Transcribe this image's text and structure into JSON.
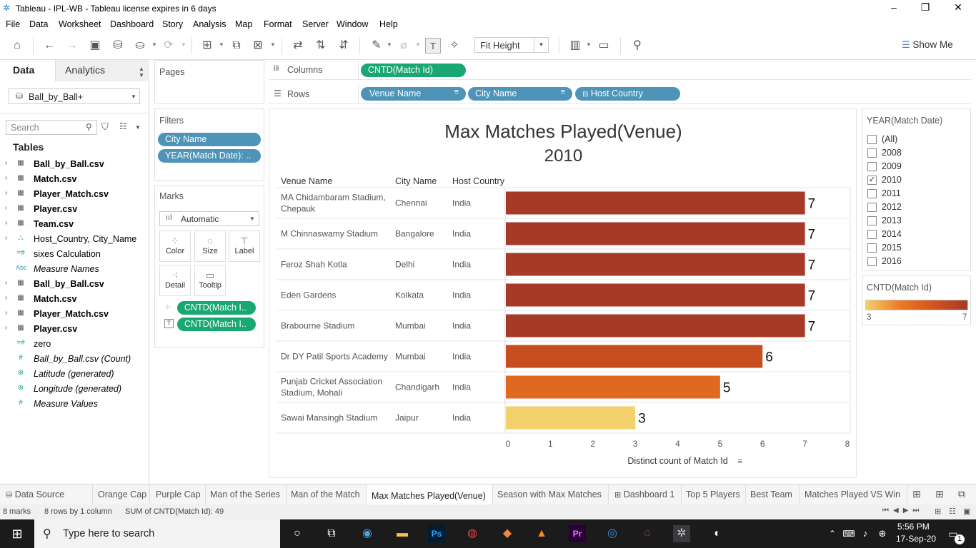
{
  "window": {
    "title": "Tableau - IPL-WB - Tableau license expires in 6 days",
    "controls": [
      "–",
      "❐",
      "✕"
    ]
  },
  "menu": [
    "File",
    "Data",
    "Worksheet",
    "Dashboard",
    "Story",
    "Analysis",
    "Map",
    "Format",
    "Server",
    "Window",
    "Help"
  ],
  "toolbar": {
    "fit": "Fit Height",
    "show_me": "Show Me"
  },
  "left_pane": {
    "tabs": [
      "Data",
      "Analytics"
    ],
    "datasource": "Ball_by_Ball+",
    "search_placeholder": "Search",
    "tables_header": "Tables",
    "fields": [
      {
        "name": "Ball_by_Ball.csv",
        "icon": "table-icon",
        "glyph": "▦",
        "arrow": "›",
        "style": "b"
      },
      {
        "name": "Match.csv",
        "icon": "table-icon",
        "glyph": "▦",
        "arrow": "›",
        "style": "b"
      },
      {
        "name": "Player_Match.csv",
        "icon": "table-icon",
        "glyph": "▦",
        "arrow": "›",
        "style": "b"
      },
      {
        "name": "Player.csv",
        "icon": "table-icon",
        "glyph": "▦",
        "arrow": "›",
        "style": "b"
      },
      {
        "name": "Team.csv",
        "icon": "table-icon",
        "glyph": "▦",
        "arrow": "›",
        "style": "b"
      },
      {
        "name": "Host_Country, City_Name",
        "icon": "hierarchy-icon",
        "glyph": "⛬",
        "arrow": "›",
        "style": ""
      },
      {
        "name": "sixes Calculation",
        "icon": "calc-icon",
        "glyph": "=#",
        "arrow": "",
        "style": ""
      },
      {
        "name": "Measure Names",
        "icon": "abc-icon",
        "glyph": "Abc",
        "arrow": "",
        "style": "it"
      },
      {
        "name": "Ball_by_Ball.csv",
        "icon": "table-icon",
        "glyph": "▦",
        "arrow": "›",
        "style": "b"
      },
      {
        "name": "Match.csv",
        "icon": "table-icon",
        "glyph": "▦",
        "arrow": "›",
        "style": "b"
      },
      {
        "name": "Player_Match.csv",
        "icon": "table-icon",
        "glyph": "▦",
        "arrow": "›",
        "style": "b"
      },
      {
        "name": "Player.csv",
        "icon": "table-icon",
        "glyph": "▦",
        "arrow": "›",
        "style": "b"
      },
      {
        "name": "zero",
        "icon": "calc-icon",
        "glyph": "=#",
        "arrow": "",
        "style": ""
      },
      {
        "name": "Ball_by_Ball.csv (Count)",
        "icon": "number-icon",
        "glyph": "#",
        "arrow": "",
        "style": "it"
      },
      {
        "name": "Latitude (generated)",
        "icon": "globe-icon",
        "glyph": "⊕",
        "arrow": "",
        "style": "it"
      },
      {
        "name": "Longitude (generated)",
        "icon": "globe-icon",
        "glyph": "⊕",
        "arrow": "",
        "style": "it"
      },
      {
        "name": "Measure Values",
        "icon": "number-icon",
        "glyph": "#",
        "arrow": "",
        "style": "it"
      }
    ]
  },
  "pages_title": "Pages",
  "filters": {
    "title": "Filters",
    "pills": [
      "City Name",
      "YEAR(Match Date): .."
    ]
  },
  "marks": {
    "title": "Marks",
    "type": "Automatic",
    "buttons": [
      "Color",
      "Size",
      "Label",
      "Detail",
      "Tooltip"
    ],
    "pills": [
      "CNTD(Match I..",
      "CNTD(Match I.."
    ]
  },
  "shelves": {
    "columns_label": "Columns",
    "columns_pill": "CNTD(Match Id)",
    "rows_label": "Rows",
    "rows_pills": [
      "Venue Name",
      "City Name",
      "Host Country"
    ]
  },
  "chart_data": {
    "type": "bar",
    "title": "Max Matches Played(Venue)",
    "subtitle": "2010",
    "headers": [
      "Venue Name",
      "City Name",
      "Host Country"
    ],
    "rows": [
      {
        "venue": "MA Chidambaram Stadium, Chepauk",
        "city": "Chennai",
        "country": "India",
        "value": 7
      },
      {
        "venue": "M Chinnaswamy Stadium",
        "city": "Bangalore",
        "country": "India",
        "value": 7
      },
      {
        "venue": "Feroz Shah Kotla",
        "city": "Delhi",
        "country": "India",
        "value": 7
      },
      {
        "venue": "Eden Gardens",
        "city": "Kolkata",
        "country": "India",
        "value": 7
      },
      {
        "venue": "Brabourne Stadium",
        "city": "Mumbai",
        "country": "India",
        "value": 7
      },
      {
        "venue": "Dr DY Patil Sports Academy",
        "city": "Mumbai",
        "country": "India",
        "value": 6
      },
      {
        "venue": "Punjab Cricket Association Stadium, Mohali",
        "city": "Chandigarh",
        "country": "India",
        "value": 5
      },
      {
        "venue": "Sawai Mansingh Stadium",
        "city": "Jaipur",
        "country": "India",
        "value": 3
      }
    ],
    "xlabel": "Distinct count of Match Id",
    "xlim": [
      0,
      8
    ],
    "xticks": [
      0,
      1,
      2,
      3,
      4,
      5,
      6,
      7,
      8
    ],
    "color_scale": {
      "min": 3,
      "max": 7,
      "colors": [
        "#f2d06b",
        "#ed7b22",
        "#d2541e",
        "#a63a26"
      ]
    }
  },
  "year_filter": {
    "title": "YEAR(Match Date)",
    "items": [
      {
        "label": "(All)",
        "checked": false
      },
      {
        "label": "2008",
        "checked": false
      },
      {
        "label": "2009",
        "checked": false
      },
      {
        "label": "2010",
        "checked": true
      },
      {
        "label": "2011",
        "checked": false
      },
      {
        "label": "2012",
        "checked": false
      },
      {
        "label": "2013",
        "checked": false
      },
      {
        "label": "2014",
        "checked": false
      },
      {
        "label": "2015",
        "checked": false
      },
      {
        "label": "2016",
        "checked": false
      }
    ]
  },
  "color_legend": {
    "title": "CNTD(Match Id)",
    "min_label": "3",
    "max_label": "7"
  },
  "sheet_tabs": {
    "items": [
      "Data Source",
      "Orange Cap",
      "Purple Cap",
      "Man of the Series",
      "Man of the Match",
      "Max Matches Played(Venue)",
      "Season with Max Matches",
      "Dashboard 1",
      "Top 5 Players",
      "Best Team",
      "Matches Played VS Win"
    ],
    "active": "Max Matches Played(Venue)"
  },
  "status": {
    "marks": "8 marks",
    "rows": "8 rows by 1 column",
    "sum": "SUM of CNTD(Match Id): 49"
  },
  "taskbar": {
    "search_placeholder": "Type here to search",
    "time": "5:56 PM",
    "date": "17-Sep-20",
    "notification_count": "1"
  }
}
